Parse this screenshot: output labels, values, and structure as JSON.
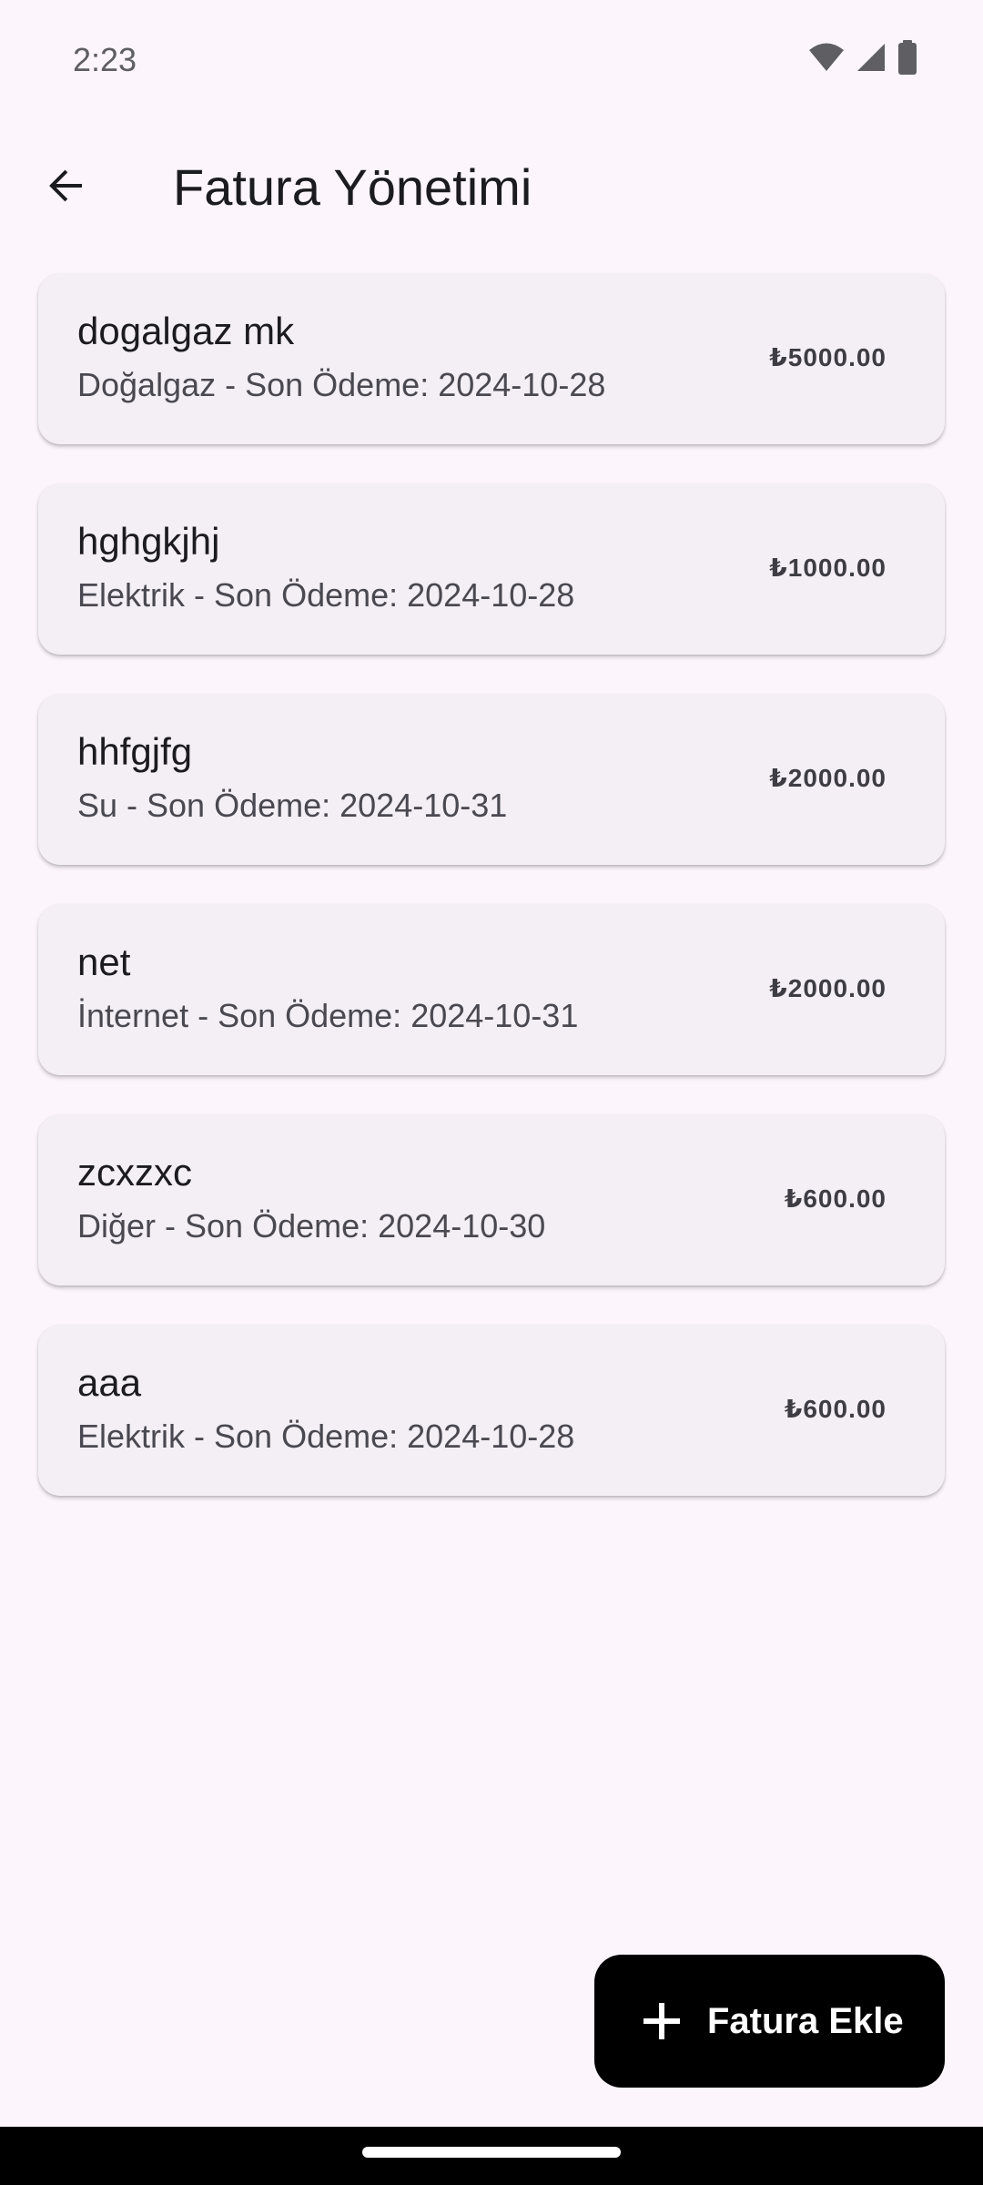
{
  "status_bar": {
    "time": "2:23",
    "icons": [
      "wifi-icon",
      "cellular-signal-icon",
      "battery-icon"
    ]
  },
  "app_bar": {
    "back_icon": "arrow-back-icon",
    "title": "Fatura Yönetimi"
  },
  "bills": [
    {
      "name": "dogalgaz mk",
      "details": "Doğalgaz - Son Ödeme: 2024-10-28",
      "amount": "₺5000.00"
    },
    {
      "name": "hghgkjhj",
      "details": "Elektrik - Son Ödeme: 2024-10-28",
      "amount": "₺1000.00"
    },
    {
      "name": "hhfgjfg",
      "details": "Su - Son Ödeme: 2024-10-31",
      "amount": "₺2000.00"
    },
    {
      "name": "net",
      "details": "İnternet - Son Ödeme: 2024-10-31",
      "amount": "₺2000.00"
    },
    {
      "name": "zcxzxc",
      "details": "Diğer - Son Ödeme: 2024-10-30",
      "amount": "₺600.00"
    },
    {
      "name": "aaa",
      "details": "Elektrik - Son Ödeme: 2024-10-28",
      "amount": "₺600.00"
    }
  ],
  "fab": {
    "icon": "plus-icon",
    "label": "Fatura Ekle"
  },
  "colors": {
    "background": "#FCF6FC",
    "card": "#F4EFF4",
    "fab": "#000000",
    "fab_text": "#FFFFFF"
  }
}
